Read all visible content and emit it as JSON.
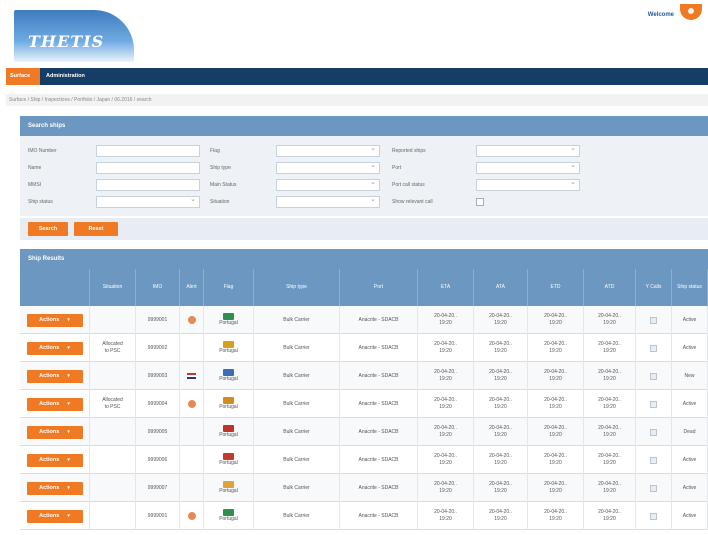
{
  "header": {
    "logo_text": "THETIS",
    "welcome": "Welcome"
  },
  "nav": {
    "items": [
      "Surface",
      "Administration"
    ]
  },
  "breadcrumb": "Surface / Ship / Inspections / Portfolio / Japan / 06.2016 / search",
  "search": {
    "title": "Search ships",
    "fields_left": [
      "IMO Number",
      "Name",
      "MMSI",
      "Ship status"
    ],
    "fields_mid": [
      "Flag",
      "Ship type",
      "Main Status",
      "Situation"
    ],
    "fields_right": [
      "Reported ships",
      "Port",
      "Port call status",
      "Show relevant call"
    ],
    "search_button": "Search",
    "reset_button": "Reset"
  },
  "results": {
    "title": "Ship Results",
    "columns": [
      "",
      "Situation",
      "IMO",
      "Alert",
      "Flag",
      "Ship type",
      "Port",
      "ETA",
      "ATA",
      "ETD",
      "ATD",
      "Y Calls",
      "Ship status"
    ],
    "action_label": "Actions",
    "rows": [
      {
        "situation": "",
        "imo": "9999001",
        "alert": "shield",
        "flag_name": "Portugal",
        "flag_color": "#2f8f4e",
        "type": "Bulk Carrier",
        "port": "Anacrite - SDACB",
        "eta": "20-04-20..\n19:20",
        "ata": "20-04-20..\n19:20",
        "etd": "20-04-20..\n19:20",
        "atd": "20-04-20..\n19:20",
        "status": "Active"
      },
      {
        "situation": "Allocated\nto PSC",
        "imo": "9999002",
        "alert": "",
        "flag_name": "Portugal",
        "flag_color": "#d4a21c",
        "type": "Bulk Carrier",
        "port": "Anacrite - SDACB",
        "eta": "20-04-20..\n19:20",
        "ata": "20-04-20..\n19:20",
        "etd": "20-04-20..\n19:20",
        "atd": "20-04-20..\n19:20",
        "status": "Active"
      },
      {
        "situation": "",
        "imo": "9999003",
        "alert": "flag",
        "flag_name": "Portugal",
        "flag_color": "#3a6fb5",
        "type": "Bulk Carrier",
        "port": "Anacrite - SDACB",
        "eta": "20-04-20..\n19:20",
        "ata": "20-04-20..\n19:20",
        "etd": "20-04-20..\n19:20",
        "atd": "20-04-20..\n19:20",
        "status": "New"
      },
      {
        "situation": "Allocated\nto PSC",
        "imo": "9999004",
        "alert": "shield",
        "flag_name": "Portugal",
        "flag_color": "#d68b1e",
        "type": "Bulk Carrier",
        "port": "Anacrite - SDACB",
        "eta": "20-04-20..\n19:20",
        "ata": "20-04-20..\n19:20",
        "etd": "20-04-20..\n19:20",
        "atd": "20-04-20..\n19:20",
        "status": "Active"
      },
      {
        "situation": "",
        "imo": "9999005",
        "alert": "",
        "flag_name": "Portugal",
        "flag_color": "#c0332b",
        "type": "Bulk Carrier",
        "port": "Anacrite - SDACB",
        "eta": "20-04-20..\n19:20",
        "ata": "20-04-20..\n19:20",
        "etd": "20-04-20..\n19:20",
        "atd": "20-04-20..\n19:20",
        "status": "Dead"
      },
      {
        "situation": "",
        "imo": "9999006",
        "alert": "",
        "flag_name": "Portugal",
        "flag_color": "#c53a2f",
        "type": "Bulk Carrier",
        "port": "Anacrite - SDACB",
        "eta": "20-04-20..\n19:20",
        "ata": "20-04-20..\n19:20",
        "etd": "20-04-20..\n19:20",
        "atd": "20-04-20..\n19:20",
        "status": "Active"
      },
      {
        "situation": "",
        "imo": "9999007",
        "alert": "",
        "flag_name": "Portugal",
        "flag_color": "#e0a23a",
        "type": "Bulk Carrier",
        "port": "Anacrite - SDACB",
        "eta": "20-04-20..\n19:20",
        "ata": "20-04-20..\n19:20",
        "etd": "20-04-20..\n19:20",
        "atd": "20-04-20..\n19:20",
        "status": "Active"
      },
      {
        "situation": "",
        "imo": "9999001",
        "alert": "shield",
        "flag_name": "Portugal",
        "flag_color": "#2f8f4e",
        "type": "Bulk Carrier",
        "port": "Anacrite - SDACB",
        "eta": "20-04-20..\n19:20",
        "ata": "20-04-20..\n19:20",
        "etd": "20-04-20..\n19:20",
        "atd": "20-04-20..\n19:20",
        "status": "Active"
      }
    ]
  },
  "colors": {
    "accent": "#f07a23",
    "nav": "#153d66",
    "panel": "#6b97c0"
  }
}
